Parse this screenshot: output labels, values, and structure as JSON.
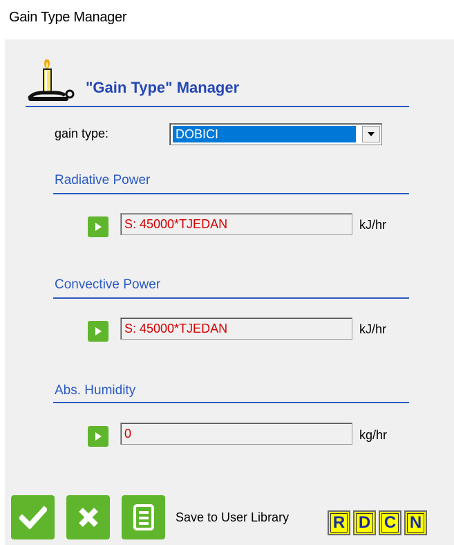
{
  "window": {
    "title": "Gain Type Manager"
  },
  "header": {
    "title": "\"Gain Type\" Manager"
  },
  "gain_type": {
    "label": "gain type:",
    "selected": "DOBICI"
  },
  "sections": [
    {
      "title": "Radiative Power",
      "value": "S: 45000*TJEDAN",
      "unit": "kJ/hr"
    },
    {
      "title": "Convective Power",
      "value": "S: 45000*TJEDAN",
      "unit": "kJ/hr"
    },
    {
      "title": "Abs. Humidity",
      "value": "0",
      "unit": "kg/hr"
    }
  ],
  "footer": {
    "save_label": "Save to User Library",
    "letter_buttons": [
      "R",
      "D",
      "C",
      "N"
    ]
  },
  "colors": {
    "accent": "#2b59c3",
    "button_green": "#5fb62c",
    "value_red": "#d20000",
    "letter_yellow": "#ffff00"
  },
  "icons": {
    "header": "candle-icon",
    "play": "play-icon",
    "ok": "check-icon",
    "cancel": "close-icon",
    "save": "save-document-icon"
  }
}
